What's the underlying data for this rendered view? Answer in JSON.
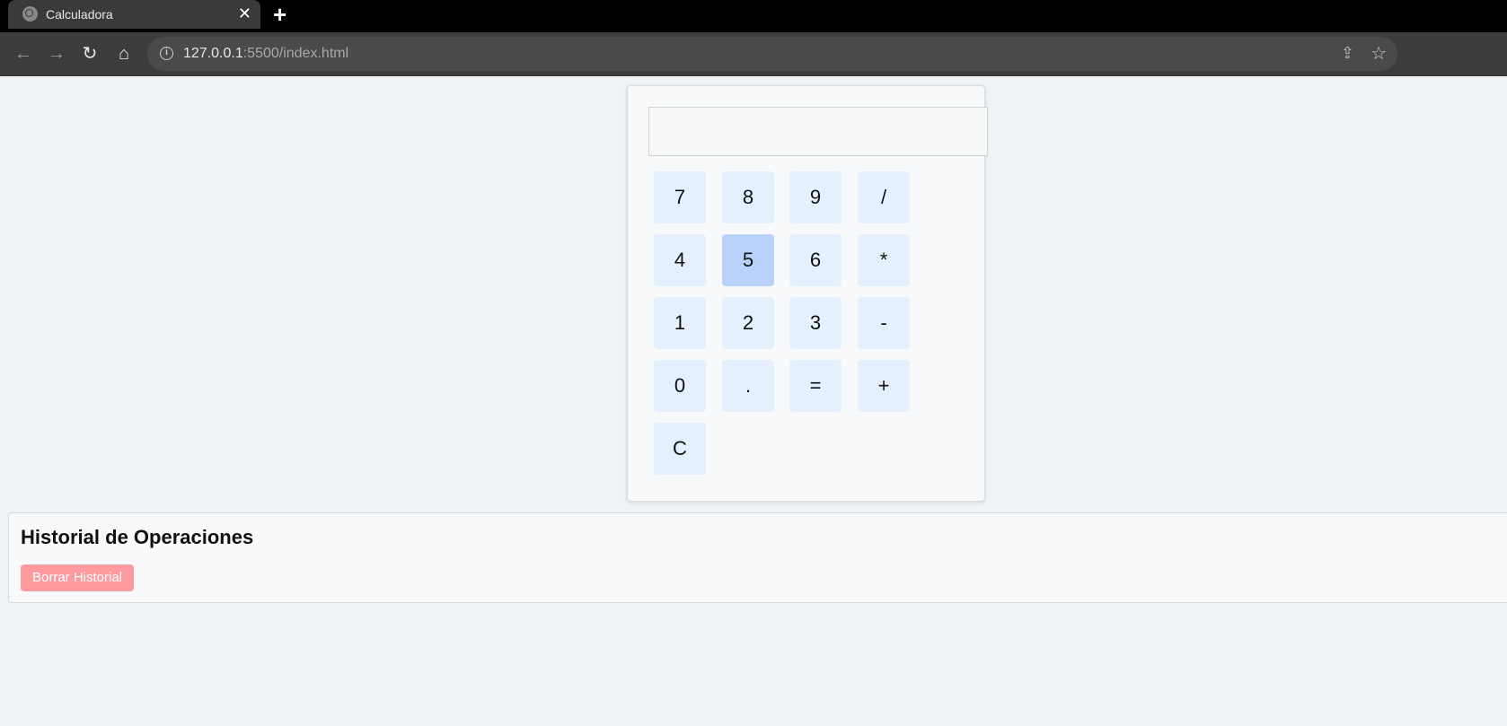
{
  "browser": {
    "tab_title": "Calculadora",
    "tab_close": "✕",
    "new_tab": "+",
    "url_host": "127.0.0.1",
    "url_rest": ":5500/index.html",
    "back": "←",
    "forward": "→",
    "reload": "↻",
    "home": "⌂",
    "info": "i",
    "share": "⇪",
    "star": "☆"
  },
  "calculator": {
    "display_value": "",
    "keys": [
      "7",
      "8",
      "9",
      "/",
      "4",
      "5",
      "6",
      "*",
      "1",
      "2",
      "3",
      "-",
      "0",
      ".",
      "=",
      "+",
      "C"
    ],
    "hovered_key": "5"
  },
  "history": {
    "title": "Historial de Operaciones",
    "clear_label": "Borrar Historial"
  },
  "colors": {
    "key_bg": "#e4f0fd",
    "key_hover_bg": "#b8d2fb",
    "clear_button_bg": "#ff9b9f"
  }
}
